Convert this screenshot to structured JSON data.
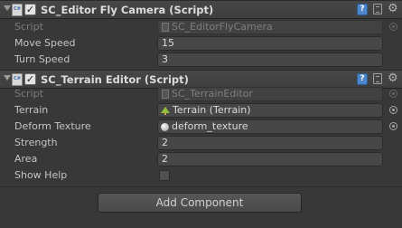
{
  "components": [
    {
      "title": "SC_Editor Fly Camera (Script)",
      "enabled": true,
      "script": {
        "label": "Script",
        "value": "SC_EditorFlyCamera"
      },
      "fields": [
        {
          "label": "Move Speed",
          "value": "15"
        },
        {
          "label": "Turn Speed",
          "value": "3"
        }
      ]
    },
    {
      "title": "SC_Terrain Editor (Script)",
      "enabled": true,
      "script": {
        "label": "Script",
        "value": "SC_TerrainEditor"
      },
      "fields": [
        {
          "label": "Terrain",
          "value": "Terrain (Terrain)",
          "icon": "terrain-icon"
        },
        {
          "label": "Deform Texture",
          "value": "deform_texture",
          "icon": "texture-icon"
        },
        {
          "label": "Strength",
          "value": "2"
        },
        {
          "label": "Area",
          "value": "2"
        },
        {
          "label": "Show Help",
          "checked": false
        }
      ]
    }
  ],
  "add_component_label": "Add Component"
}
